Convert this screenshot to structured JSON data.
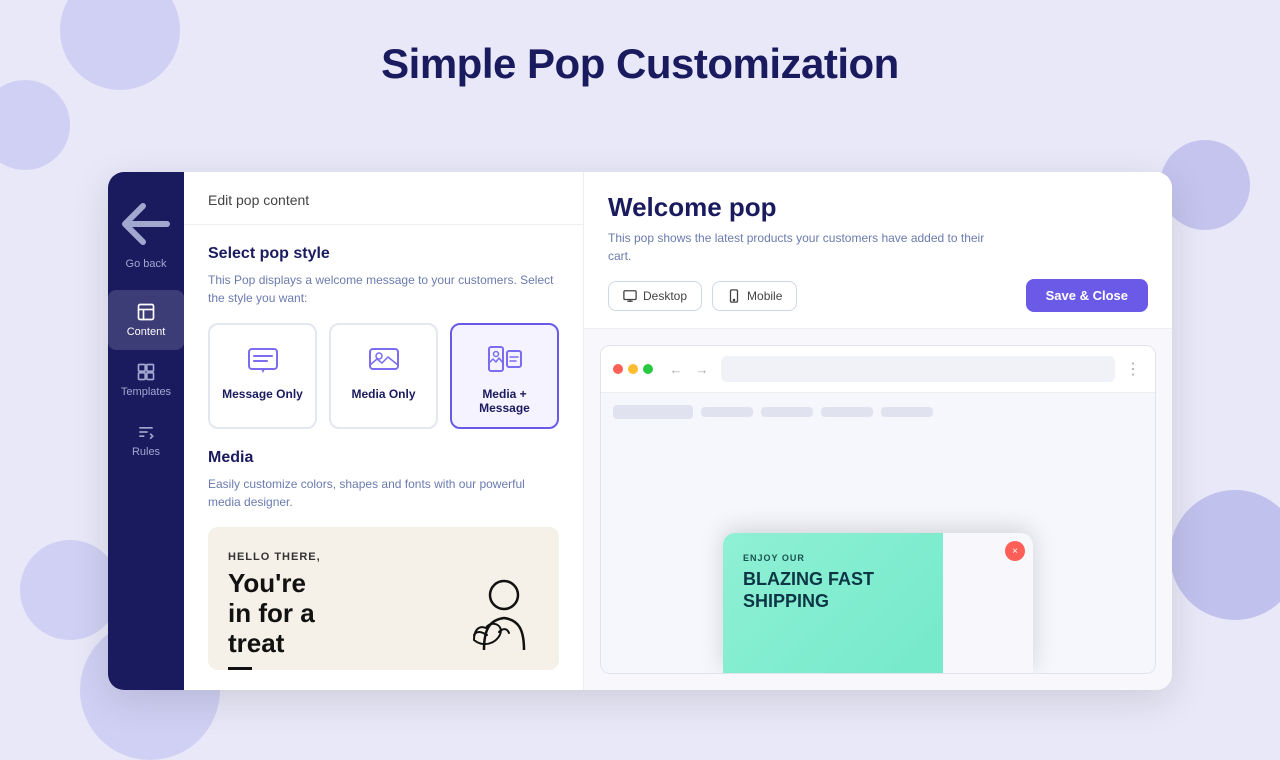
{
  "page": {
    "title": "Simple Pop Customization",
    "background_color": "#e8e8f8"
  },
  "sidebar": {
    "go_back_label": "Go back",
    "items": [
      {
        "id": "content",
        "label": "Content",
        "active": true
      },
      {
        "id": "templates",
        "label": "Templates",
        "active": false
      },
      {
        "id": "rules",
        "label": "Rules",
        "active": false
      }
    ]
  },
  "left_panel": {
    "header": "Edit pop content",
    "pop_style": {
      "title": "Select pop style",
      "description": "This Pop displays a welcome message to your customers. Select the style you want:",
      "options": [
        {
          "id": "message-only",
          "label": "Message Only",
          "active": false
        },
        {
          "id": "media-only",
          "label": "Media Only",
          "active": false
        },
        {
          "id": "media-message",
          "label": "Media + Message",
          "active": true
        }
      ]
    },
    "media": {
      "title": "Media",
      "description": "Easily customize colors, shapes and fonts with our powerful media designer.",
      "preview": {
        "hello": "HELLO THERE,",
        "headline_line1": "You're",
        "headline_line2": "in for a",
        "headline_line3": "treat"
      }
    }
  },
  "right_panel": {
    "title": "Welcome pop",
    "description": "This pop shows the latest products your customers have added to their cart.",
    "view_buttons": [
      {
        "id": "desktop",
        "label": "Desktop"
      },
      {
        "id": "mobile",
        "label": "Mobile"
      }
    ],
    "save_button": "Save & Close",
    "popup": {
      "close_button": "×",
      "label": "ENJOY OUR",
      "headline_line1": "BLAZING FAST",
      "headline_line2": "SHIPPING"
    }
  }
}
